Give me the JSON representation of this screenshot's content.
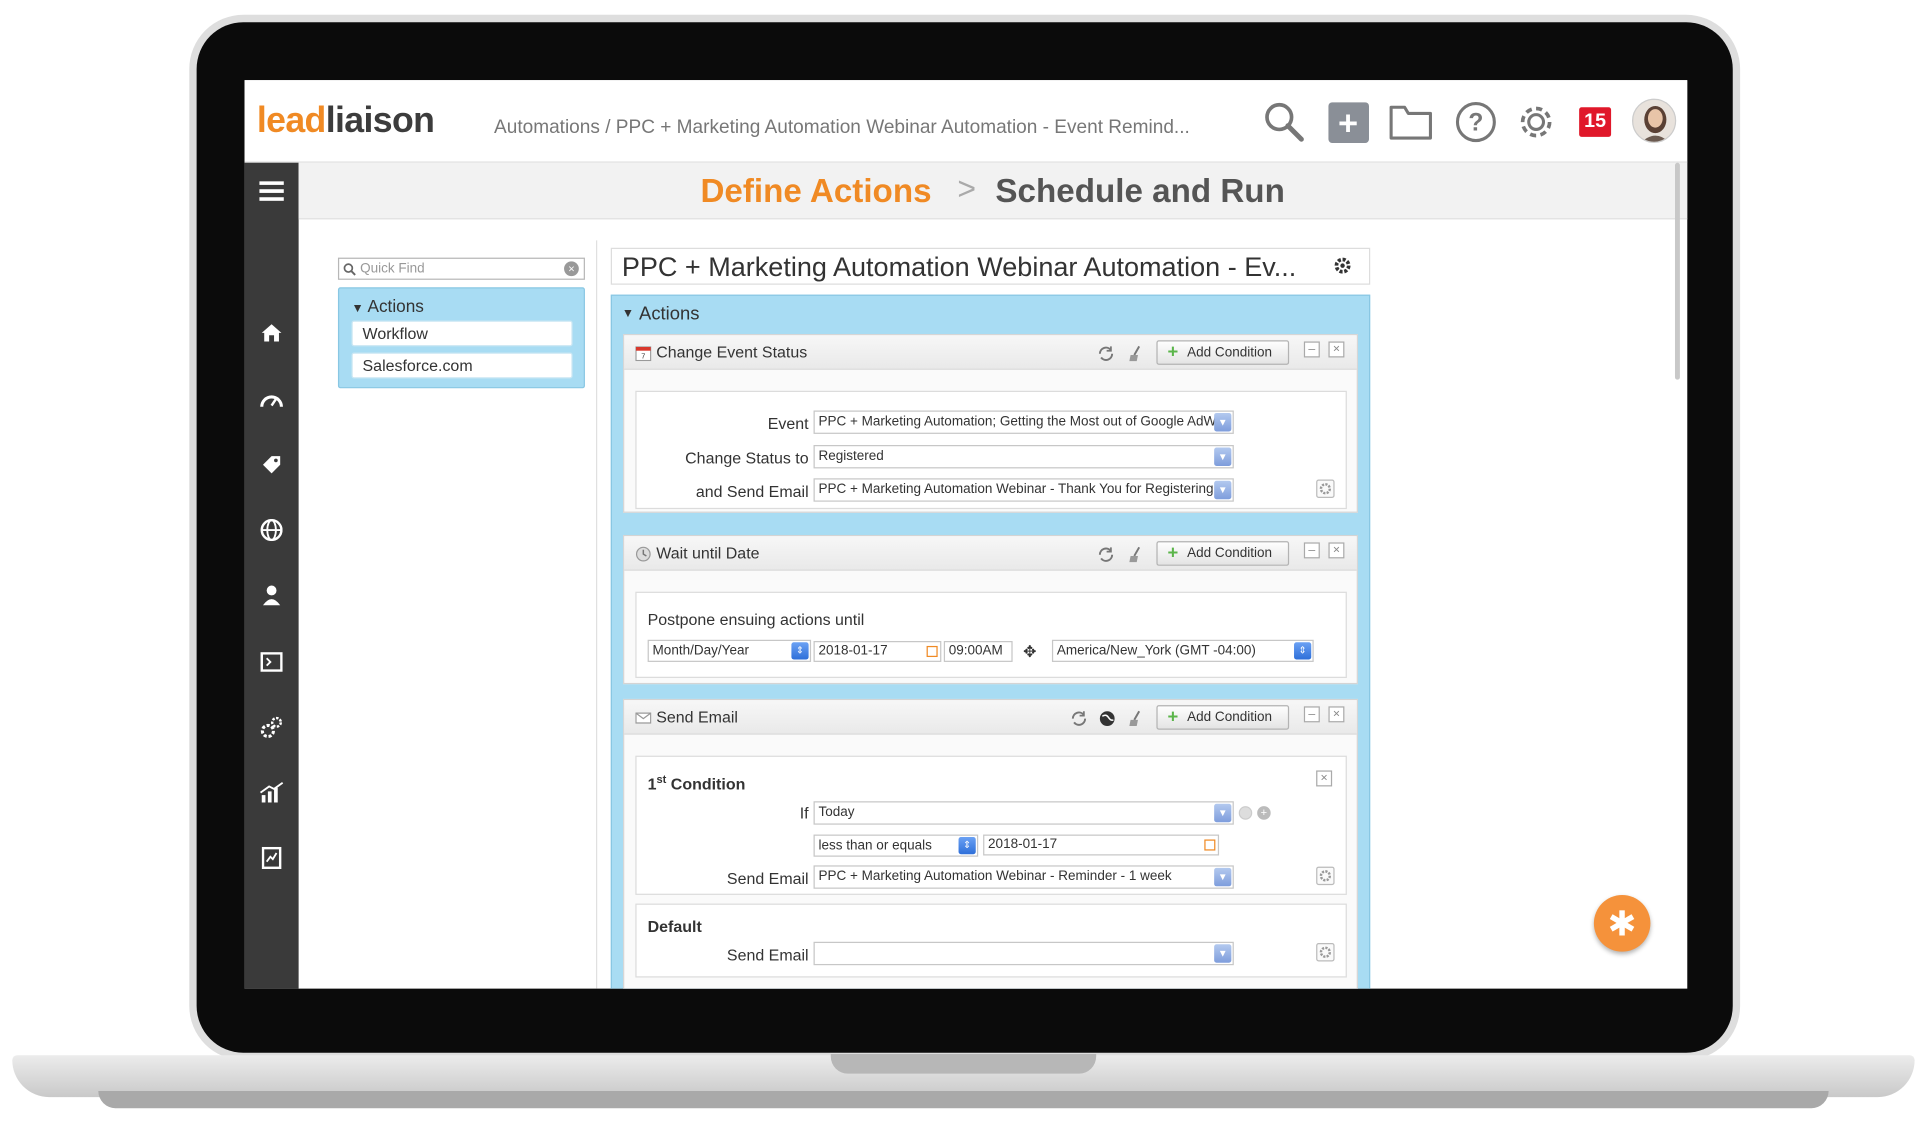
{
  "brand": {
    "logo_a": "lead",
    "logo_b": "liaison",
    "accent": "#f08a24"
  },
  "breadcrumb": {
    "root": "Automations",
    "sep": " / ",
    "current": "PPC + Marketing Automation Webinar Automation - Event Remind..."
  },
  "topbar": {
    "notification_count": "15"
  },
  "steps": {
    "step1": "Define Actions",
    "separator": ">",
    "step2": "Schedule and Run"
  },
  "left_panel": {
    "quick_find_placeholder": "Quick Find",
    "section_title": "Actions",
    "items": [
      {
        "label": "Workflow"
      },
      {
        "label": "Salesforce.com"
      }
    ]
  },
  "main": {
    "title": "PPC + Marketing Automation Webinar Automation - Ev...",
    "section_title": "Actions",
    "add_condition_label": "Add Condition",
    "change_event": {
      "title": "Change Event Status",
      "event_label": "Event",
      "event_value": "PPC + Marketing Automation; Getting the Most out of Google AdW",
      "status_label": "Change Status to",
      "status_value": "Registered",
      "email_label": "and Send Email",
      "email_value": "PPC + Marketing Automation Webinar - Thank You for Registering"
    },
    "wait": {
      "title": "Wait until Date",
      "postpone_label": "Postpone ensuing actions until",
      "date_format": "Month/Day/Year",
      "date": "2018-01-17",
      "time": "09:00AM",
      "timezone": "America/New_York (GMT -04:00)"
    },
    "send_email": {
      "title": "Send Email",
      "condition_prefix": "1",
      "condition_sup": "st",
      "condition_suffix": " Condition",
      "if_label": "If",
      "if_value": "Today",
      "operator": "less than or equals",
      "date": "2018-01-17",
      "send_label": "Send Email",
      "send_value": "PPC + Marketing Automation Webinar - Reminder - 1 week",
      "default_title": "Default",
      "default_send_label": "Send Email",
      "default_send_value": ""
    }
  }
}
